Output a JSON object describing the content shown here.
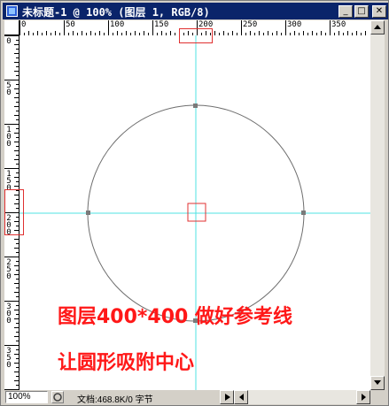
{
  "window": {
    "title": "未标题-1 @ 100% (图层 1, RGB/8)",
    "minimize_glyph": "_",
    "maximize_glyph": "□",
    "close_glyph": "✕"
  },
  "rulers": {
    "horizontal_labels": [
      "0",
      "50",
      "100",
      "150",
      "200",
      "250",
      "300",
      "350"
    ],
    "vertical_labels": [
      "0",
      "50",
      "100",
      "150",
      "200",
      "250",
      "300",
      "350"
    ]
  },
  "annotations": {
    "line1": "图层400*400 做好参考线",
    "line2": "让圆形吸附中心"
  },
  "status": {
    "zoom": "100%",
    "doc_info": "文档:468.8K/0 字节"
  },
  "colors": {
    "guide": "#4fe3e3",
    "annotation": "#ff1818",
    "highlight_box": "#e03030",
    "title_bar": "#0a246a"
  },
  "icons": {
    "title": "photoshop-document-icon",
    "status": "status-menu-icon"
  }
}
